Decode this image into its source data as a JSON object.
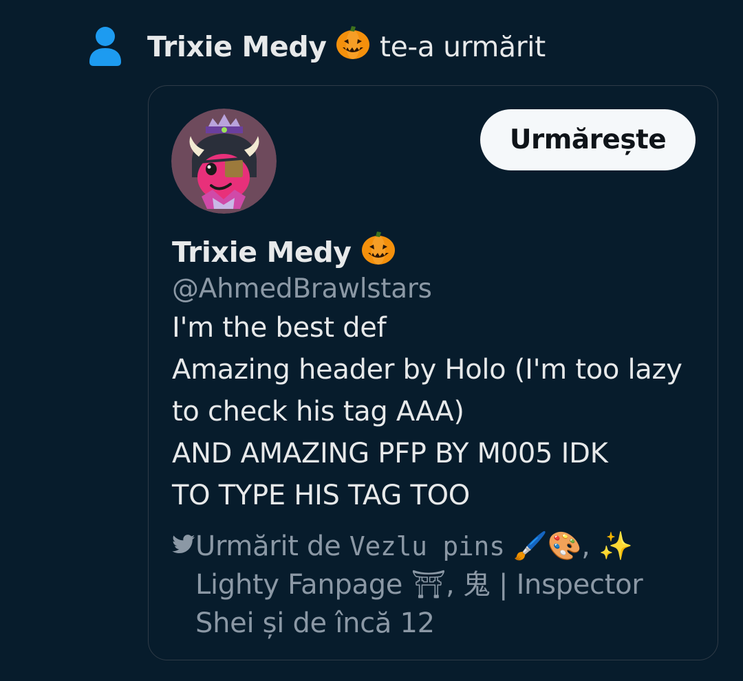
{
  "notification": {
    "icon": "person-icon",
    "actor_name": "Trixie Medy",
    "actor_emoji": "pumpkin-icon",
    "action_text": "te-a urmărit"
  },
  "card": {
    "avatar": "avatar",
    "follow_button_label": "Urmărește",
    "profile_name": "Trixie Medy",
    "profile_emoji": "pumpkin-icon",
    "handle": "@AhmedBrawlstars",
    "bio_lines": [
      "I'm the best def",
      "Amazing header by Holo (I'm too lazy",
      "to check his tag AAA)",
      "AND AMAZING PFP BY M005 IDK",
      "TO TYPE HIS TAG TOO"
    ],
    "followed_by": {
      "icon": "bird-icon",
      "prefix": "Urmărit de ",
      "user1_name": "Vezlu pins",
      "user1_emojis": "🖌️🎨",
      "sep1": ", ",
      "user2_emoji": "✨",
      "user2_name": "Lighty Fanpage ⛩, 鬼",
      "sep2": " | ",
      "user3_name_part1": "Inspector",
      "user3_name_part2": "Shei",
      "suffix": " și de încă 12"
    }
  },
  "colors": {
    "background": "#071c2c",
    "text_primary": "#e7e9ea",
    "text_secondary": "#8b98a5",
    "accent": "#1d9bf0",
    "card_border": "#2f3b47",
    "button_bg": "#f5f8fa",
    "button_text": "#0f1419"
  }
}
